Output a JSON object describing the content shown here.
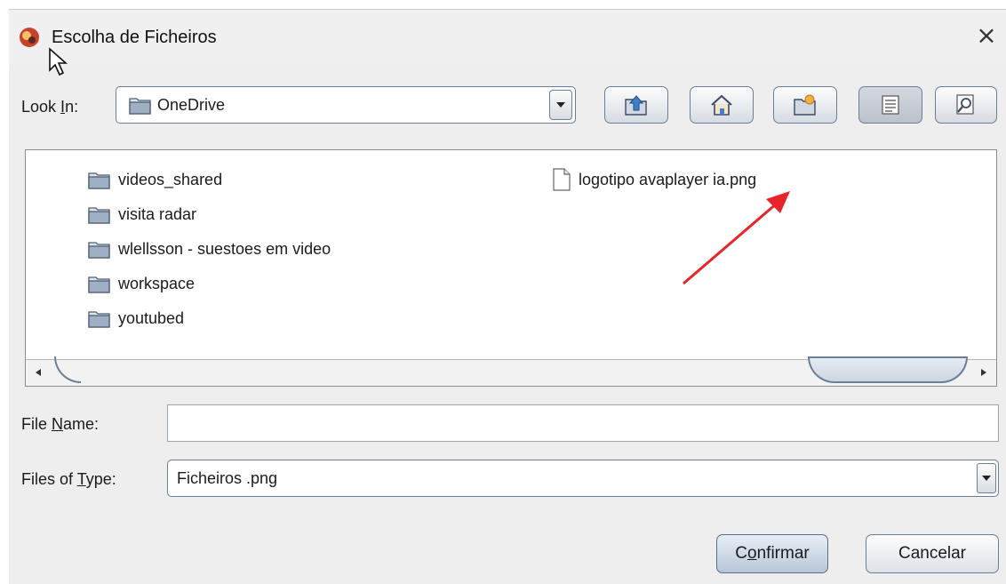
{
  "window": {
    "title": "Escolha de Ficheiros",
    "close_label": "×"
  },
  "look_in": {
    "label_pre": "Look ",
    "label_mnemonic": "I",
    "label_post": "n:",
    "value": "OneDrive"
  },
  "toolbar": {
    "buttons": [
      {
        "name": "up-one-level-button",
        "icon": "folder-up-icon"
      },
      {
        "name": "home-button",
        "icon": "home-icon"
      },
      {
        "name": "new-folder-button",
        "icon": "new-folder-icon"
      },
      {
        "name": "list-view-button",
        "icon": "list-view-icon",
        "selected": true
      },
      {
        "name": "details-view-button",
        "icon": "details-view-icon"
      }
    ]
  },
  "files": {
    "folders": [
      "videos_shared",
      "visita radar",
      "wlellsson - suestoes em video",
      "workspace",
      "youtubed"
    ],
    "file_items": [
      "logotipo avaplayer ia.png"
    ]
  },
  "file_name": {
    "label_pre": "File ",
    "label_mnemonic": "N",
    "label_post": "ame:",
    "value": ""
  },
  "file_type": {
    "label_pre": "Files of ",
    "label_mnemonic": "T",
    "label_post": "ype:",
    "value": "Ficheiros .png"
  },
  "actions": {
    "confirm_pre": "C",
    "confirm_mnemonic": "o",
    "confirm_post": "nfirmar",
    "cancel": "Cancelar"
  },
  "colors": {
    "annotation_arrow": "#e8232a",
    "folder": "#8a9aae"
  }
}
